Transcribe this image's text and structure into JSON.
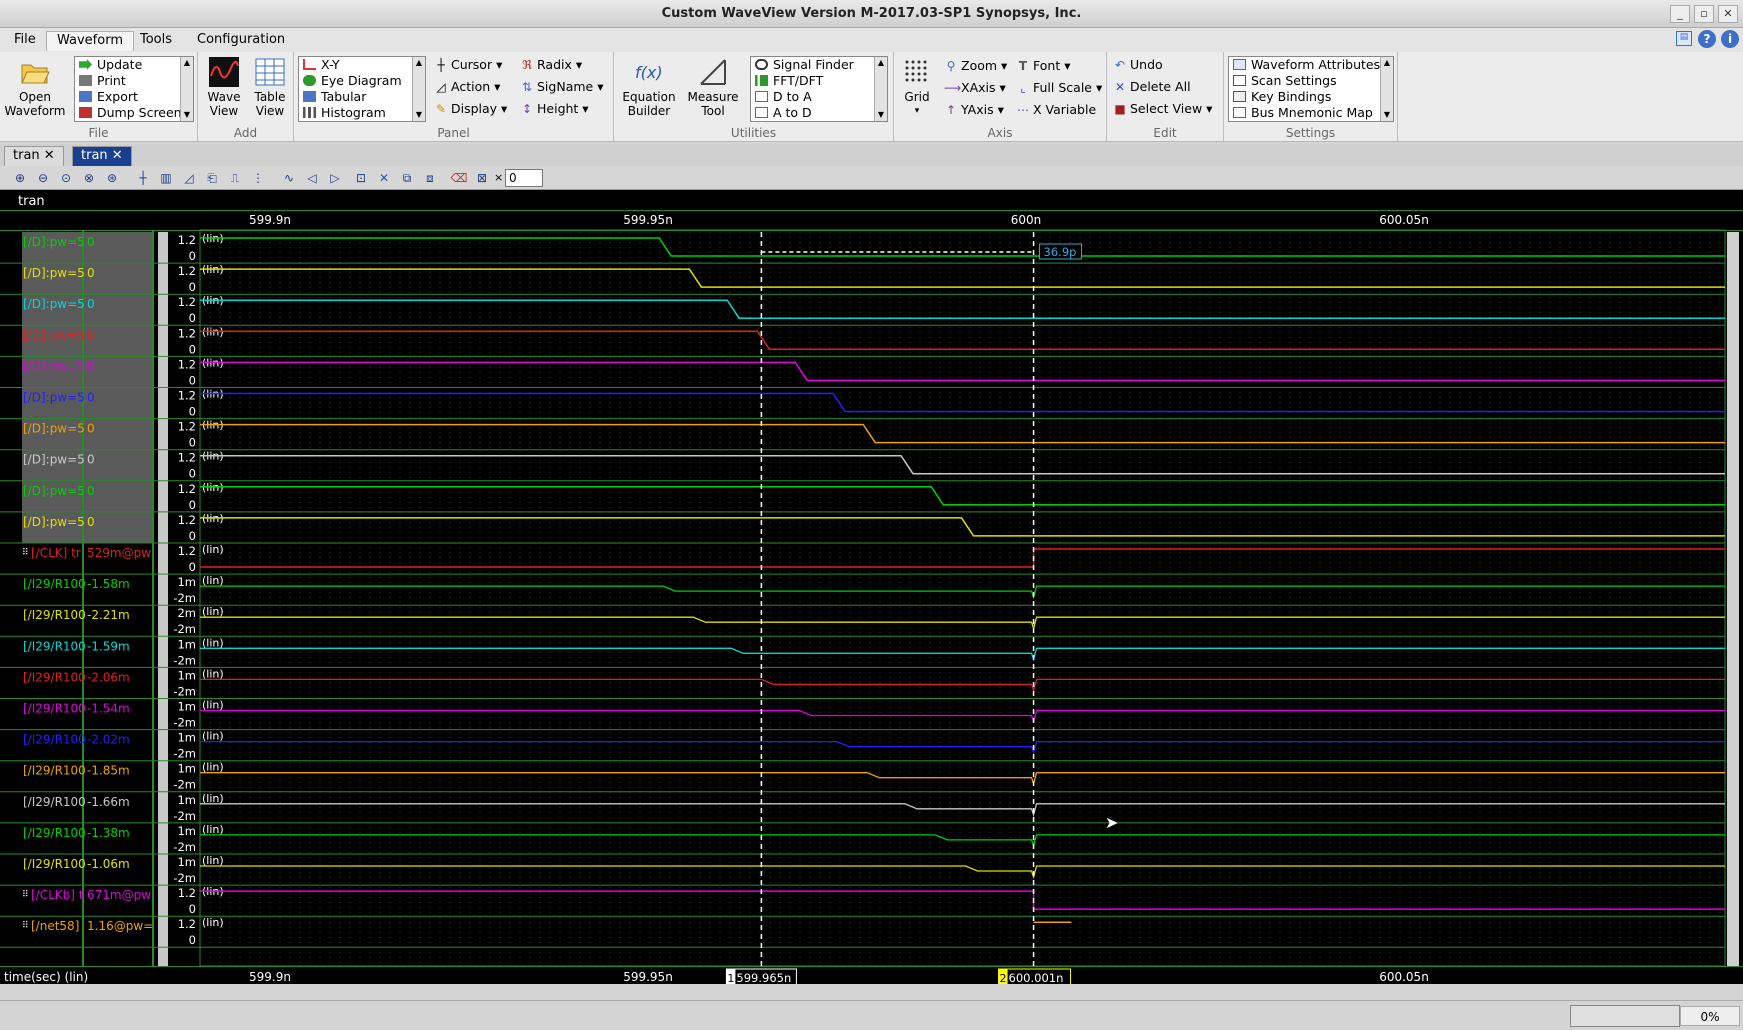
{
  "window": {
    "title": "Custom WaveView Version M-2017.03-SP1 Synopsys, Inc."
  },
  "menu": [
    "File",
    "Waveform",
    "Tools",
    "Configuration"
  ],
  "ribbon": {
    "file": {
      "open_label": "Open\nWaveform",
      "items": [
        "Update",
        "Print",
        "Export",
        "Dump Screen"
      ],
      "group": "File"
    },
    "add": {
      "wave_view": "Wave\nView",
      "table_view": "Table\nView",
      "group": "Add"
    },
    "panel": {
      "items": [
        "X-Y",
        "Eye Diagram",
        "Tabular",
        "Histogram"
      ],
      "buttons": [
        "Cursor",
        "Action",
        "Display",
        "Radix",
        "SigName",
        "Height"
      ],
      "group": "Panel"
    },
    "utilities": {
      "equation": "Equation\nBuilder",
      "measure": "Measure\nTool",
      "items": [
        "Signal Finder",
        "FFT/DFT",
        "D to A",
        "A to D"
      ],
      "group": "Utilities"
    },
    "axis": {
      "grid": "Grid",
      "buttons": [
        "Zoom",
        "XAxis",
        "YAxis",
        "Font",
        "Full Scale",
        "X Variable"
      ],
      "group": "Axis"
    },
    "edit": {
      "buttons": [
        "Undo",
        "Delete All",
        "Select View"
      ],
      "group": "Edit"
    },
    "settings": {
      "items": [
        "Waveform Attributes",
        "Scan Settings",
        "Key Bindings",
        "Bus Mnemonic Map"
      ],
      "group": "Settings"
    }
  },
  "tabs": [
    "tran",
    "tran"
  ],
  "zoom_field": "0",
  "panel_title": "tran",
  "x_ticks": [
    "599.9n",
    "599.95n",
    "600n",
    "600.05n"
  ],
  "x_axis_label": "time(sec) (lin)",
  "cursors": {
    "c1": {
      "num": "1",
      "label": "599.965n"
    },
    "c2": {
      "num": "2",
      "label": "600.001n"
    },
    "delta": "36.9p"
  },
  "status": {
    "progress": "0%"
  },
  "colors": {
    "green": "#00d000",
    "yellow": "#e0e000",
    "cyan": "#00d8d8",
    "red": "#e02020",
    "magenta": "#e000e0",
    "blue": "#2020ff",
    "orange": "#f0a000",
    "gray": "#c8c8c8"
  },
  "signals": [
    {
      "name": "[/D]:pw=5",
      "value": "0",
      "color": "green",
      "axis": [
        "1.2",
        "0"
      ],
      "unit": "(lin)"
    },
    {
      "name": "[/D]:pw=5",
      "value": "0",
      "color": "yellow",
      "axis": [
        "1.2",
        "0"
      ],
      "unit": "(lin)"
    },
    {
      "name": "[/D]:pw=5",
      "value": "0",
      "color": "cyan",
      "axis": [
        "1.2",
        "0"
      ],
      "unit": "(lin)"
    },
    {
      "name": "[/D]:pw=5",
      "value": "0",
      "color": "red",
      "axis": [
        "1.2",
        "0"
      ],
      "unit": "(lin)"
    },
    {
      "name": "[/D]:pw=5",
      "value": "0",
      "color": "magenta",
      "axis": [
        "1.2",
        "0"
      ],
      "unit": "(lin)"
    },
    {
      "name": "[/D]:pw=5",
      "value": "0",
      "color": "blue",
      "axis": [
        "1.2",
        "0"
      ],
      "unit": "(lin)"
    },
    {
      "name": "[/D]:pw=5",
      "value": "0",
      "color": "orange",
      "axis": [
        "1.2",
        "0"
      ],
      "unit": "(lin)"
    },
    {
      "name": "[/D]:pw=5",
      "value": "0",
      "color": "gray",
      "axis": [
        "1.2",
        "0"
      ],
      "unit": "(lin)"
    },
    {
      "name": "[/D]:pw=5",
      "value": "0",
      "color": "green",
      "axis": [
        "1.2",
        "0"
      ],
      "unit": "(lin)"
    },
    {
      "name": "[/D]:pw=5",
      "value": "0",
      "color": "yellow",
      "axis": [
        "1.2",
        "0"
      ],
      "unit": "(lin)"
    },
    {
      "name": "[/CLK] tr",
      "value": "529m@pw",
      "color": "red",
      "axis": [
        "1.2",
        "0"
      ],
      "unit": "(lin)",
      "expand": true
    },
    {
      "name": "[/I29/R100",
      "value": "-1.58m",
      "color": "green",
      "axis": [
        "1m",
        "-2m"
      ],
      "unit": "(lin)"
    },
    {
      "name": "[/I29/R100",
      "value": "-2.21m",
      "color": "yellow",
      "axis": [
        "2m",
        "-2m"
      ],
      "unit": "(lin)"
    },
    {
      "name": "[/I29/R100",
      "value": "-1.59m",
      "color": "cyan",
      "axis": [
        "1m",
        "-2m"
      ],
      "unit": "(lin)"
    },
    {
      "name": "[/I29/R100",
      "value": "-2.06m",
      "color": "red",
      "axis": [
        "1m",
        "-2m"
      ],
      "unit": "(lin)"
    },
    {
      "name": "[/I29/R100",
      "value": "-1.54m",
      "color": "magenta",
      "axis": [
        "1m",
        "-2m"
      ],
      "unit": "(lin)"
    },
    {
      "name": "[/I29/R100",
      "value": "-2.02m",
      "color": "blue",
      "axis": [
        "1m",
        "-2m"
      ],
      "unit": "(lin)"
    },
    {
      "name": "[/I29/R100",
      "value": "-1.85m",
      "color": "orange",
      "axis": [
        "1m",
        "-2m"
      ],
      "unit": "(lin)"
    },
    {
      "name": "[/I29/R100",
      "value": "-1.66m",
      "color": "gray",
      "axis": [
        "1m",
        "-2m"
      ],
      "unit": "(lin)"
    },
    {
      "name": "[/I29/R100",
      "value": "-1.38m",
      "color": "green",
      "axis": [
        "1m",
        "-2m"
      ],
      "unit": "(lin)"
    },
    {
      "name": "[/I29/R100",
      "value": "-1.06m",
      "color": "yellow",
      "axis": [
        "1m",
        "-2m"
      ],
      "unit": "(lin)"
    },
    {
      "name": "[/CLKb] t",
      "value": "671m@pw",
      "color": "magenta",
      "axis": [
        "1.2",
        "0"
      ],
      "unit": "(lin)",
      "expand": true
    },
    {
      "name": "[/net58]",
      "value": "1.16@pw=",
      "color": "orange",
      "axis": [
        "1.2",
        "0"
      ],
      "unit": "(lin)",
      "expand": true
    }
  ],
  "transitions_ns": [
    599.952,
    599.956,
    599.961,
    599.965,
    599.97,
    599.975,
    599.979,
    599.984,
    599.988,
    599.992,
    600.001
  ]
}
